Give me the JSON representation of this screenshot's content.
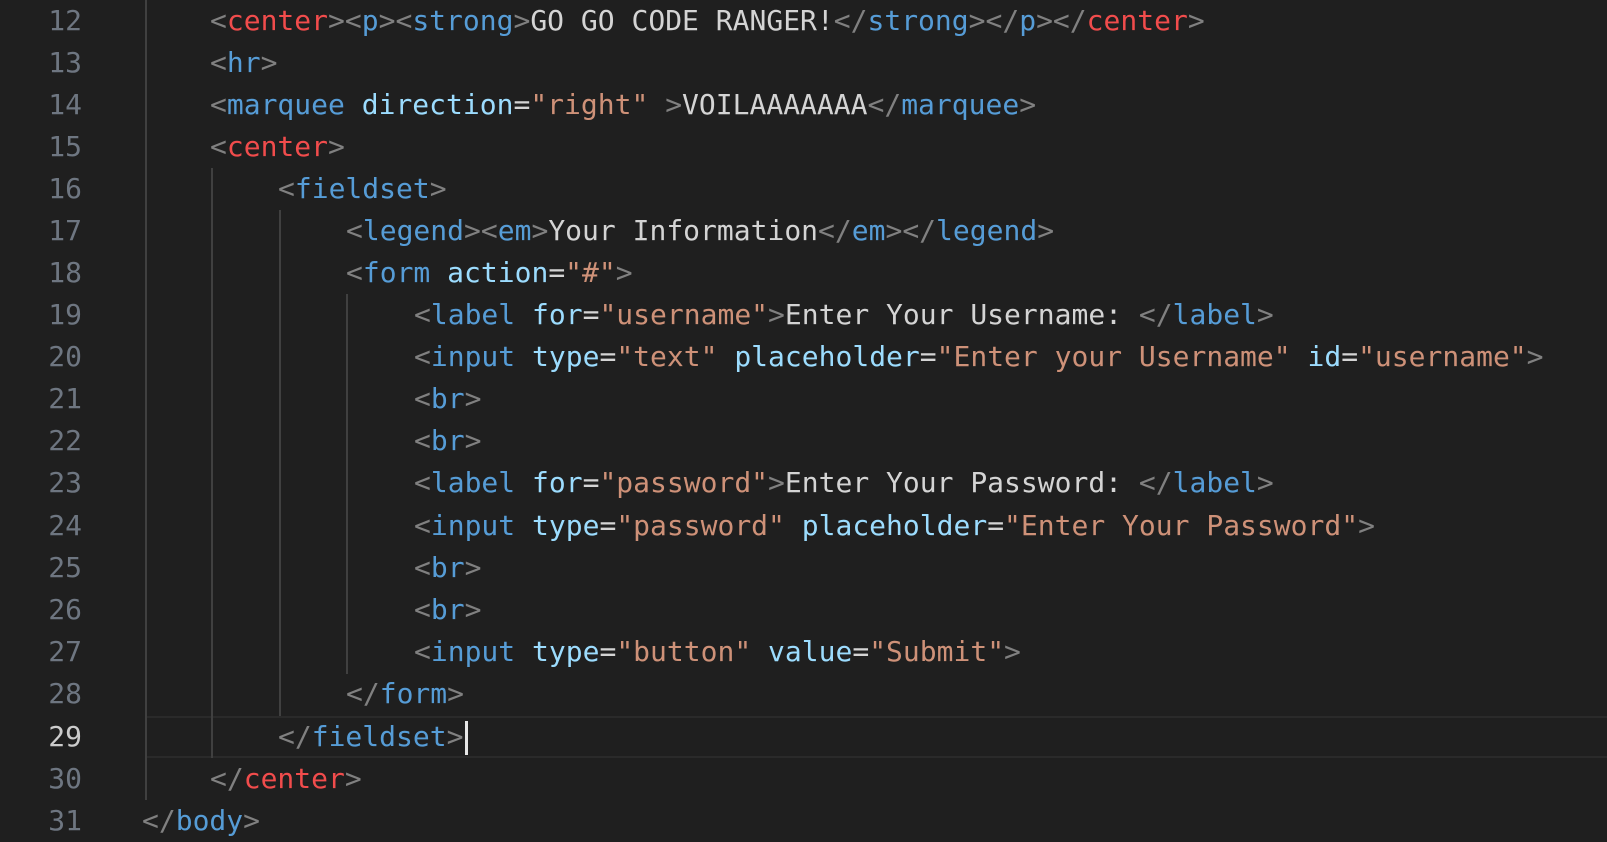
{
  "gutter": {
    "line_numbers": [
      "12",
      "13",
      "14",
      "15",
      "16",
      "17",
      "18",
      "19",
      "20",
      "21",
      "22",
      "23",
      "24",
      "25",
      "26",
      "27",
      "28",
      "29",
      "30",
      "31"
    ],
    "active_line": "29"
  },
  "code": {
    "l12": {
      "t1": "center",
      "t2": "p",
      "t3": "strong",
      "text": "GO GO CODE RANGER!",
      "c3": "strong",
      "c2": "p",
      "c1": "center"
    },
    "l13": {
      "t1": "hr"
    },
    "l14": {
      "t1": "marquee",
      "a1": "direction",
      "v1": "\"right\"",
      "text": "VOILAAAAAAA",
      "c1": "marquee"
    },
    "l15": {
      "t1": "center"
    },
    "l16": {
      "t1": "fieldset"
    },
    "l17": {
      "t1": "legend",
      "t2": "em",
      "text": "Your Information",
      "c2": "em",
      "c1": "legend"
    },
    "l18": {
      "t1": "form",
      "a1": "action",
      "v1": "\"#\""
    },
    "l19": {
      "t1": "label",
      "a1": "for",
      "v1": "\"username\"",
      "text": "Enter Your Username: ",
      "c1": "label"
    },
    "l20": {
      "t1": "input",
      "a1": "type",
      "v1": "\"text\"",
      "a2": "placeholder",
      "v2": "\"Enter your Username\"",
      "a3": "id",
      "v3": "\"username\""
    },
    "l21": {
      "t1": "br"
    },
    "l22": {
      "t1": "br"
    },
    "l23": {
      "t1": "label",
      "a1": "for",
      "v1": "\"password\"",
      "text": "Enter Your Password: ",
      "c1": "label"
    },
    "l24": {
      "t1": "input",
      "a1": "type",
      "v1": "\"password\"",
      "a2": "placeholder",
      "v2": "\"Enter Your Password\""
    },
    "l25": {
      "t1": "br"
    },
    "l26": {
      "t1": "br"
    },
    "l27": {
      "t1": "input",
      "a1": "type",
      "v1": "\"button\"",
      "a2": "value",
      "v2": "\"Submit\""
    },
    "l28": {
      "c1": "form"
    },
    "l29": {
      "c1": "fieldset"
    },
    "l30": {
      "c1": "center"
    },
    "l31": {
      "c1": "body"
    }
  },
  "theme": {
    "background": "#1f1f1f",
    "line_number": "#6e7681",
    "line_number_active": "#cccccc",
    "punctuation": "#808080",
    "tag_red": "#f14c4c",
    "tag_blue": "#569cd6",
    "attribute": "#9cdcfe",
    "string": "#ce9178",
    "text": "#d4d4d4"
  }
}
